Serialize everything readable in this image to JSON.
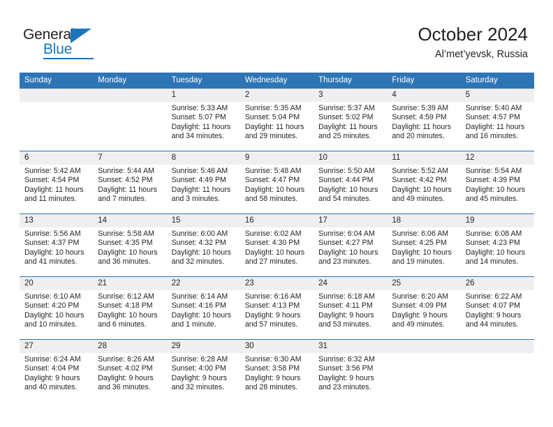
{
  "brand": {
    "name_line1": "General",
    "name_line2": "Blue",
    "triangle_icon": "triangle-icon",
    "accent_color": "#1b75bb"
  },
  "header": {
    "title": "October 2024",
    "subtitle": "Al’met’yevsk, Russia"
  },
  "theme": {
    "header_blue": "#2e75b6",
    "daynum_gray": "#efefef",
    "text": "#231f20"
  },
  "calendar": {
    "weekday_headers": [
      "Sunday",
      "Monday",
      "Tuesday",
      "Wednesday",
      "Thursday",
      "Friday",
      "Saturday"
    ],
    "labels": {
      "sunrise": "Sunrise:",
      "sunset": "Sunset:",
      "daylight": "Daylight:"
    },
    "weeks": [
      [
        {
          "day": "",
          "blank": true
        },
        {
          "day": "",
          "blank": true
        },
        {
          "day": "1",
          "sunrise": "Sunrise: 5:33 AM",
          "sunset": "Sunset: 5:07 PM",
          "daylight_1": "Daylight: 11 hours",
          "daylight_2": "and 34 minutes."
        },
        {
          "day": "2",
          "sunrise": "Sunrise: 5:35 AM",
          "sunset": "Sunset: 5:04 PM",
          "daylight_1": "Daylight: 11 hours",
          "daylight_2": "and 29 minutes."
        },
        {
          "day": "3",
          "sunrise": "Sunrise: 5:37 AM",
          "sunset": "Sunset: 5:02 PM",
          "daylight_1": "Daylight: 11 hours",
          "daylight_2": "and 25 minutes."
        },
        {
          "day": "4",
          "sunrise": "Sunrise: 5:39 AM",
          "sunset": "Sunset: 4:59 PM",
          "daylight_1": "Daylight: 11 hours",
          "daylight_2": "and 20 minutes."
        },
        {
          "day": "5",
          "sunrise": "Sunrise: 5:40 AM",
          "sunset": "Sunset: 4:57 PM",
          "daylight_1": "Daylight: 11 hours",
          "daylight_2": "and 16 minutes."
        }
      ],
      [
        {
          "day": "6",
          "sunrise": "Sunrise: 5:42 AM",
          "sunset": "Sunset: 4:54 PM",
          "daylight_1": "Daylight: 11 hours",
          "daylight_2": "and 11 minutes."
        },
        {
          "day": "7",
          "sunrise": "Sunrise: 5:44 AM",
          "sunset": "Sunset: 4:52 PM",
          "daylight_1": "Daylight: 11 hours",
          "daylight_2": "and 7 minutes."
        },
        {
          "day": "8",
          "sunrise": "Sunrise: 5:46 AM",
          "sunset": "Sunset: 4:49 PM",
          "daylight_1": "Daylight: 11 hours",
          "daylight_2": "and 3 minutes."
        },
        {
          "day": "9",
          "sunrise": "Sunrise: 5:48 AM",
          "sunset": "Sunset: 4:47 PM",
          "daylight_1": "Daylight: 10 hours",
          "daylight_2": "and 58 minutes."
        },
        {
          "day": "10",
          "sunrise": "Sunrise: 5:50 AM",
          "sunset": "Sunset: 4:44 PM",
          "daylight_1": "Daylight: 10 hours",
          "daylight_2": "and 54 minutes."
        },
        {
          "day": "11",
          "sunrise": "Sunrise: 5:52 AM",
          "sunset": "Sunset: 4:42 PM",
          "daylight_1": "Daylight: 10 hours",
          "daylight_2": "and 49 minutes."
        },
        {
          "day": "12",
          "sunrise": "Sunrise: 5:54 AM",
          "sunset": "Sunset: 4:39 PM",
          "daylight_1": "Daylight: 10 hours",
          "daylight_2": "and 45 minutes."
        }
      ],
      [
        {
          "day": "13",
          "sunrise": "Sunrise: 5:56 AM",
          "sunset": "Sunset: 4:37 PM",
          "daylight_1": "Daylight: 10 hours",
          "daylight_2": "and 41 minutes."
        },
        {
          "day": "14",
          "sunrise": "Sunrise: 5:58 AM",
          "sunset": "Sunset: 4:35 PM",
          "daylight_1": "Daylight: 10 hours",
          "daylight_2": "and 36 minutes."
        },
        {
          "day": "15",
          "sunrise": "Sunrise: 6:00 AM",
          "sunset": "Sunset: 4:32 PM",
          "daylight_1": "Daylight: 10 hours",
          "daylight_2": "and 32 minutes."
        },
        {
          "day": "16",
          "sunrise": "Sunrise: 6:02 AM",
          "sunset": "Sunset: 4:30 PM",
          "daylight_1": "Daylight: 10 hours",
          "daylight_2": "and 27 minutes."
        },
        {
          "day": "17",
          "sunrise": "Sunrise: 6:04 AM",
          "sunset": "Sunset: 4:27 PM",
          "daylight_1": "Daylight: 10 hours",
          "daylight_2": "and 23 minutes."
        },
        {
          "day": "18",
          "sunrise": "Sunrise: 6:06 AM",
          "sunset": "Sunset: 4:25 PM",
          "daylight_1": "Daylight: 10 hours",
          "daylight_2": "and 19 minutes."
        },
        {
          "day": "19",
          "sunrise": "Sunrise: 6:08 AM",
          "sunset": "Sunset: 4:23 PM",
          "daylight_1": "Daylight: 10 hours",
          "daylight_2": "and 14 minutes."
        }
      ],
      [
        {
          "day": "20",
          "sunrise": "Sunrise: 6:10 AM",
          "sunset": "Sunset: 4:20 PM",
          "daylight_1": "Daylight: 10 hours",
          "daylight_2": "and 10 minutes."
        },
        {
          "day": "21",
          "sunrise": "Sunrise: 6:12 AM",
          "sunset": "Sunset: 4:18 PM",
          "daylight_1": "Daylight: 10 hours",
          "daylight_2": "and 6 minutes."
        },
        {
          "day": "22",
          "sunrise": "Sunrise: 6:14 AM",
          "sunset": "Sunset: 4:16 PM",
          "daylight_1": "Daylight: 10 hours",
          "daylight_2": "and 1 minute."
        },
        {
          "day": "23",
          "sunrise": "Sunrise: 6:16 AM",
          "sunset": "Sunset: 4:13 PM",
          "daylight_1": "Daylight: 9 hours",
          "daylight_2": "and 57 minutes."
        },
        {
          "day": "24",
          "sunrise": "Sunrise: 6:18 AM",
          "sunset": "Sunset: 4:11 PM",
          "daylight_1": "Daylight: 9 hours",
          "daylight_2": "and 53 minutes."
        },
        {
          "day": "25",
          "sunrise": "Sunrise: 6:20 AM",
          "sunset": "Sunset: 4:09 PM",
          "daylight_1": "Daylight: 9 hours",
          "daylight_2": "and 49 minutes."
        },
        {
          "day": "26",
          "sunrise": "Sunrise: 6:22 AM",
          "sunset": "Sunset: 4:07 PM",
          "daylight_1": "Daylight: 9 hours",
          "daylight_2": "and 44 minutes."
        }
      ],
      [
        {
          "day": "27",
          "sunrise": "Sunrise: 6:24 AM",
          "sunset": "Sunset: 4:04 PM",
          "daylight_1": "Daylight: 9 hours",
          "daylight_2": "and 40 minutes."
        },
        {
          "day": "28",
          "sunrise": "Sunrise: 6:26 AM",
          "sunset": "Sunset: 4:02 PM",
          "daylight_1": "Daylight: 9 hours",
          "daylight_2": "and 36 minutes."
        },
        {
          "day": "29",
          "sunrise": "Sunrise: 6:28 AM",
          "sunset": "Sunset: 4:00 PM",
          "daylight_1": "Daylight: 9 hours",
          "daylight_2": "and 32 minutes."
        },
        {
          "day": "30",
          "sunrise": "Sunrise: 6:30 AM",
          "sunset": "Sunset: 3:58 PM",
          "daylight_1": "Daylight: 9 hours",
          "daylight_2": "and 28 minutes."
        },
        {
          "day": "31",
          "sunrise": "Sunrise: 6:32 AM",
          "sunset": "Sunset: 3:56 PM",
          "daylight_1": "Daylight: 9 hours",
          "daylight_2": "and 23 minutes."
        },
        {
          "day": "",
          "blank": true
        },
        {
          "day": "",
          "blank": true
        }
      ]
    ]
  }
}
